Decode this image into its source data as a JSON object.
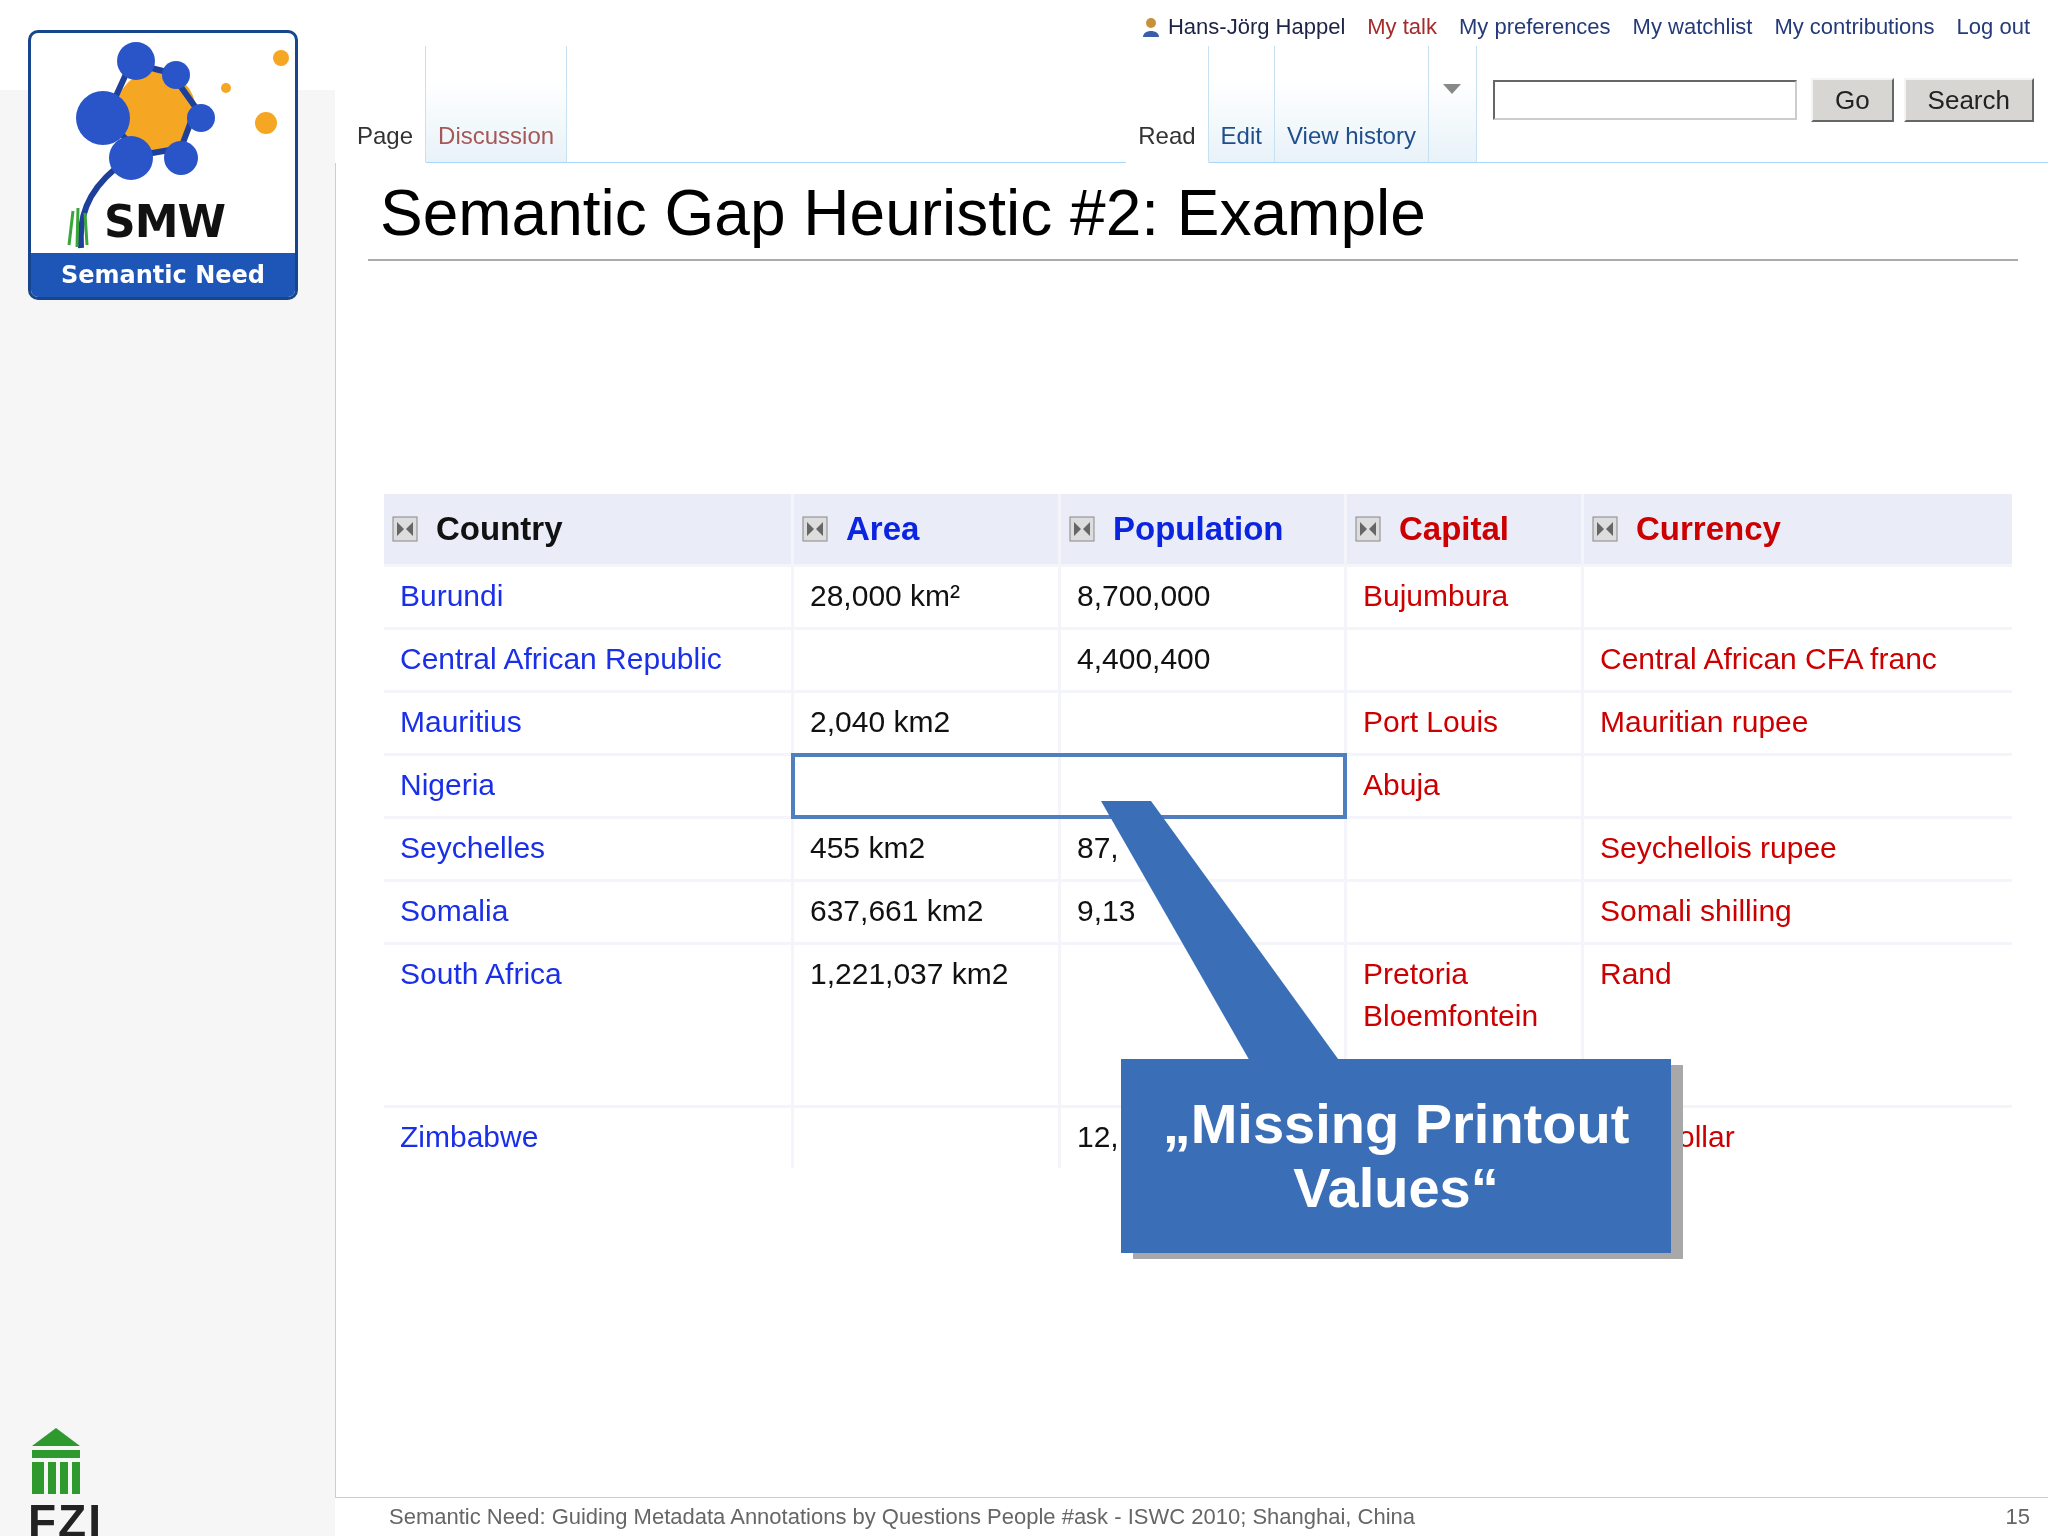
{
  "logo": {
    "mark": "SMW",
    "caption": "Semantic Need"
  },
  "user_links": [
    {
      "label": "Hans-Jörg Happel",
      "kind": "user"
    },
    {
      "label": "My talk",
      "kind": "new"
    },
    {
      "label": "My preferences",
      "kind": "link"
    },
    {
      "label": "My watchlist",
      "kind": "link"
    },
    {
      "label": "My contributions",
      "kind": "link"
    },
    {
      "label": "Log out",
      "kind": "link"
    }
  ],
  "page_tabs": [
    {
      "label": "Page",
      "selected": true,
      "kind": "link"
    },
    {
      "label": "Discussion",
      "selected": false,
      "kind": "new"
    }
  ],
  "view_tabs": [
    {
      "label": "Read",
      "selected": true
    },
    {
      "label": "Edit",
      "selected": false
    },
    {
      "label": "View history",
      "selected": false
    }
  ],
  "search": {
    "buttons": [
      "Go",
      "Search"
    ]
  },
  "title": "Semantic Gap Heuristic #2: Example",
  "table": {
    "columns": [
      {
        "label": "Country",
        "kind": "plain"
      },
      {
        "label": "Area",
        "kind": "link"
      },
      {
        "label": "Population",
        "kind": "link"
      },
      {
        "label": "Capital",
        "kind": "new"
      },
      {
        "label": "Currency",
        "kind": "new"
      }
    ],
    "rows": [
      {
        "cells": [
          {
            "kind": "link",
            "lines": [
              "Burundi"
            ]
          },
          {
            "kind": "plain",
            "lines": [
              "28,000 km²"
            ]
          },
          {
            "kind": "plain",
            "lines": [
              "8,700,000"
            ]
          },
          {
            "kind": "new",
            "lines": [
              "Bujumbura"
            ]
          },
          {
            "kind": "empty"
          }
        ]
      },
      {
        "cells": [
          {
            "kind": "link",
            "lines": [
              "Central African Republic"
            ]
          },
          {
            "kind": "empty"
          },
          {
            "kind": "plain",
            "lines": [
              "4,400,400"
            ]
          },
          {
            "kind": "empty"
          },
          {
            "kind": "new",
            "lines": [
              "Central African CFA franc"
            ]
          }
        ]
      },
      {
        "cells": [
          {
            "kind": "link",
            "lines": [
              "Mauritius"
            ]
          },
          {
            "kind": "plain",
            "lines": [
              "2,040 km2"
            ]
          },
          {
            "kind": "empty"
          },
          {
            "kind": "new",
            "lines": [
              "Port Louis"
            ]
          },
          {
            "kind": "new",
            "lines": [
              "Mauritian rupee"
            ]
          }
        ]
      },
      {
        "cells": [
          {
            "kind": "link",
            "lines": [
              "Nigeria"
            ]
          },
          {
            "kind": "empty",
            "highlighted": true
          },
          {
            "kind": "empty",
            "highlighted": true
          },
          {
            "kind": "new",
            "lines": [
              "Abuja"
            ]
          },
          {
            "kind": "empty"
          }
        ]
      },
      {
        "cells": [
          {
            "kind": "link",
            "lines": [
              "Seychelles"
            ]
          },
          {
            "kind": "plain",
            "lines": [
              "455 km2"
            ]
          },
          {
            "kind": "plain",
            "lines": [
              "87,"
            ]
          },
          {
            "kind": "empty"
          },
          {
            "kind": "new",
            "lines": [
              "Seychellois rupee"
            ]
          }
        ]
      },
      {
        "cells": [
          {
            "kind": "link",
            "lines": [
              "Somalia"
            ]
          },
          {
            "kind": "plain",
            "lines": [
              "637,661 km2"
            ]
          },
          {
            "kind": "plain",
            "lines": [
              "9,13"
            ]
          },
          {
            "kind": "empty"
          },
          {
            "kind": "new",
            "lines": [
              "Somali shilling"
            ]
          }
        ]
      },
      {
        "cells": [
          {
            "kind": "link",
            "lines": [
              "South Africa"
            ]
          },
          {
            "kind": "plain",
            "lines": [
              "1,221,037 km2"
            ]
          },
          {
            "kind": "empty"
          },
          {
            "kind": "new",
            "lines": [
              "Pretoria",
              "Bloemfontein"
            ]
          },
          {
            "kind": "new",
            "lines": [
              "Rand"
            ]
          }
        ]
      },
      {
        "cells": [
          {
            "kind": "link",
            "lines": [
              "Zimbabwe"
            ]
          },
          {
            "kind": "empty"
          },
          {
            "kind": "plain",
            "lines": [
              "12,"
            ]
          },
          {
            "kind": "empty"
          },
          {
            "kind": "new",
            "lines": [
              "ollar"
            ],
            "partly_covered": true
          }
        ]
      }
    ]
  },
  "callout": {
    "text": "„Missing Printout Values“"
  },
  "footer": {
    "text": "Semantic Need: Guiding Metadata Annotations by Questions People #ask - ISWC 2010; Shanghai, China",
    "page": "15"
  },
  "org_logo": {
    "label": "FZI"
  }
}
